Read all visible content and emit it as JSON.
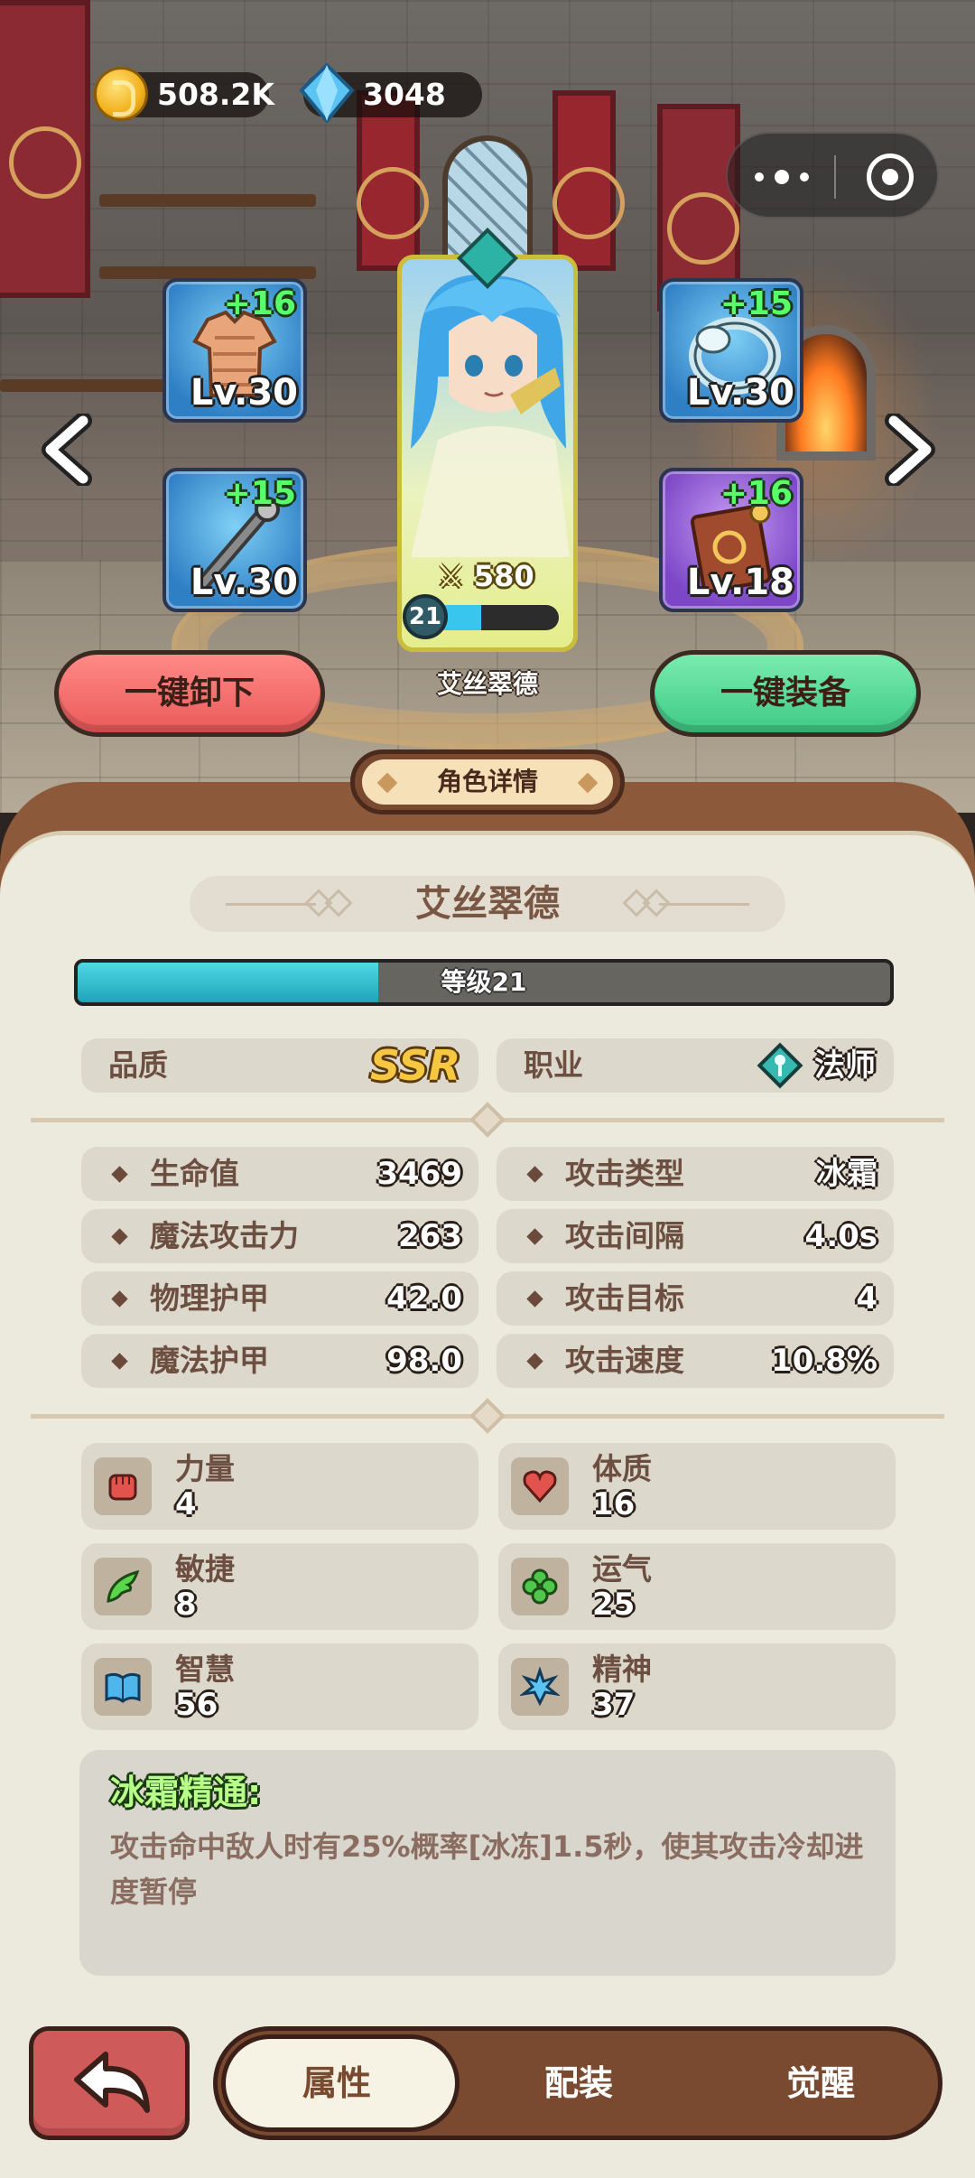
{
  "currency": {
    "gold": "508.2K",
    "diamonds": "3048"
  },
  "equipment": [
    {
      "plus": "+16",
      "level": "Lv.30",
      "icon": "armor-icon",
      "rarity_color": "#3e8fd6"
    },
    {
      "plus": "+15",
      "level": "Lv.30",
      "icon": "ring-icon",
      "rarity_color": "#3e8fd6"
    },
    {
      "plus": "+15",
      "level": "Lv.30",
      "icon": "staff-icon",
      "rarity_color": "#3e8fd6"
    },
    {
      "plus": "+16",
      "level": "Lv.18",
      "icon": "spellbook-icon",
      "rarity_color": "#8b52d0"
    }
  ],
  "hero": {
    "name": "艾丝翠德",
    "power": "580",
    "level": "21",
    "exp_fraction": 0.45
  },
  "actions": {
    "unequip_all": "一键卸下",
    "equip_all": "一键装备"
  },
  "detail": {
    "tab_title": "角色详情",
    "name": "艾丝翠德",
    "level_label": "等级21",
    "level_fraction": 0.37,
    "quality_label": "品质",
    "quality_value": "SSR",
    "class_label": "职业",
    "class_value": "法师"
  },
  "stats_left": [
    {
      "label": "生命值",
      "value": "3469"
    },
    {
      "label": "魔法攻击力",
      "value": "263"
    },
    {
      "label": "物理护甲",
      "value": "42.0"
    },
    {
      "label": "魔法护甲",
      "value": "98.0"
    }
  ],
  "stats_right": [
    {
      "label": "攻击类型",
      "value": "冰霜"
    },
    {
      "label": "攻击间隔",
      "value": "4.0s"
    },
    {
      "label": "攻击目标",
      "value": "4"
    },
    {
      "label": "攻击速度",
      "value": "10.8%"
    }
  ],
  "attributes": [
    {
      "label": "力量",
      "value": "4",
      "icon": "fist-icon"
    },
    {
      "label": "体质",
      "value": "16",
      "icon": "heart-icon"
    },
    {
      "label": "敏捷",
      "value": "8",
      "icon": "wing-icon"
    },
    {
      "label": "运气",
      "value": "25",
      "icon": "clover-icon"
    },
    {
      "label": "智慧",
      "value": "56",
      "icon": "book-icon"
    },
    {
      "label": "精神",
      "value": "37",
      "icon": "spirit-icon"
    }
  ],
  "skill": {
    "title": "冰霜精通:",
    "description": "攻击命中敌人时有25%概率[冰冻]1.5秒，使其攻击冷却进度暂停"
  },
  "nav": {
    "tabs": [
      "属性",
      "配装",
      "觉醒"
    ],
    "active": 0
  }
}
